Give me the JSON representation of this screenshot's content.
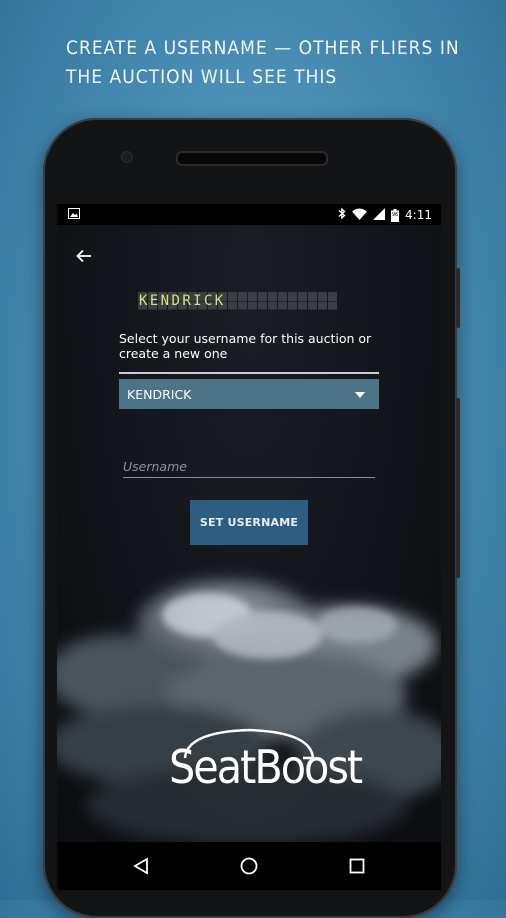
{
  "promo": {
    "headline": "CREATE A USERNAME — OTHER FLIERS IN THE AUCTION WILL SEE THIS"
  },
  "statusbar": {
    "time": "4:11",
    "battery": "96"
  },
  "app": {
    "flapboard": {
      "value": "KENDRICK",
      "slots": 20
    },
    "helper_text": "Select your username for this auction or create a new one",
    "dropdown": {
      "selected": "KENDRICK"
    },
    "username_input": {
      "value": "",
      "placeholder": "Username"
    },
    "set_button": "SET USERNAME",
    "logo": "SeatBoost"
  },
  "colors": {
    "background": "#4a8fb5",
    "dropdown": "#4d7386",
    "button": "#2d5e82",
    "flap_text": "#d8e27a"
  }
}
